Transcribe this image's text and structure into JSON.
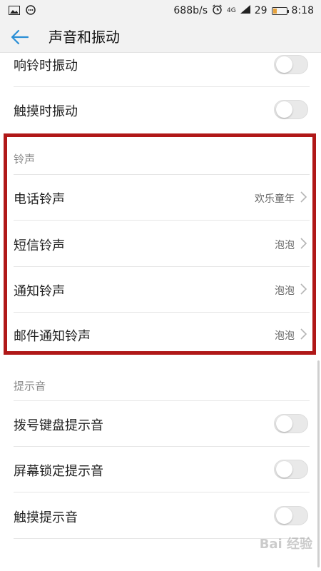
{
  "status_bar": {
    "speed": "688b/s",
    "network": "4G",
    "battery": "29",
    "time": "8:18"
  },
  "app_bar": {
    "title": "声音和振动"
  },
  "items": {
    "ring_vibrate": "响铃时振动",
    "touch_vibrate": "触摸时振动",
    "ringtone_section": "铃声",
    "phone_ringtone": {
      "label": "电话铃声",
      "value": "欢乐童年"
    },
    "sms_ringtone": {
      "label": "短信铃声",
      "value": "泡泡"
    },
    "notification_ringtone": {
      "label": "通知铃声",
      "value": "泡泡"
    },
    "mail_ringtone": {
      "label": "邮件通知铃声",
      "value": "泡泡"
    },
    "tone_section": "提示音",
    "dialpad_tone": "拨号键盘提示音",
    "lock_tone": "屏幕锁定提示音",
    "touch_tone": "触摸提示音"
  },
  "watermark": "Bai 经验",
  "colors": {
    "accent": "#2a8fd6",
    "highlight": "#b01818"
  }
}
